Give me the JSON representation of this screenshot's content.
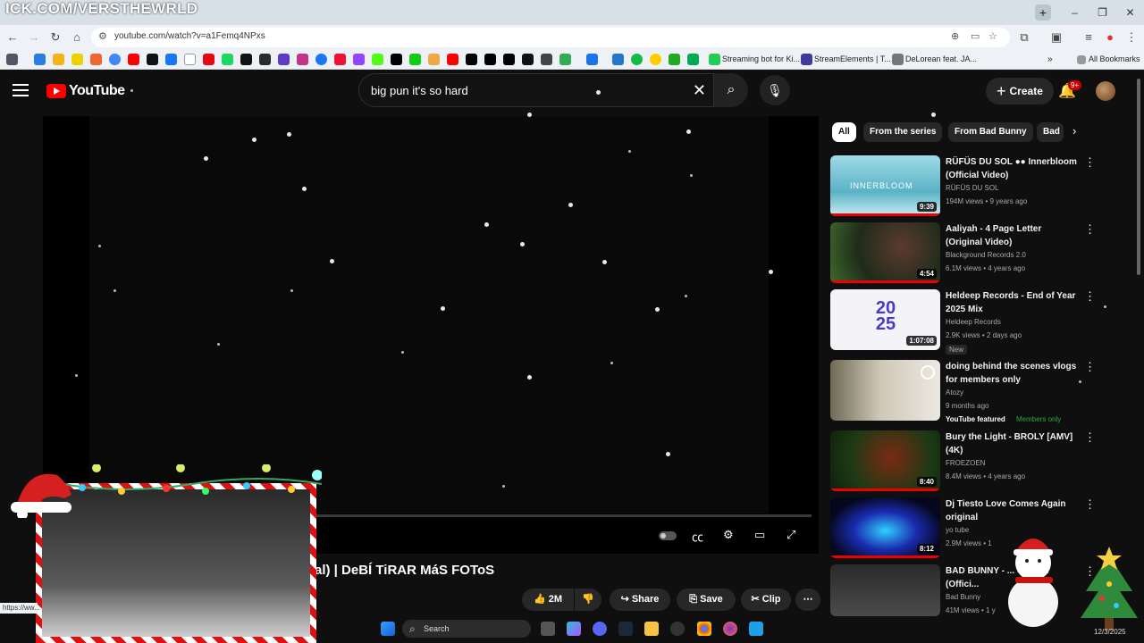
{
  "overlay": {
    "banner": "ICK.COM/VERSTHEWRLD"
  },
  "browser": {
    "url": "youtube.com/watch?v=a1Femq4NPxs",
    "bookmark_labels": [
      "Streaming bot for Ki...",
      "StreamElements | T...",
      "DeLorean feat. JA..."
    ],
    "all_bookmarks": "All Bookmarks",
    "status_url": "https://ww..."
  },
  "youtube": {
    "logo_text": "YouTube",
    "search_query": "big pun it's so hard",
    "create_label": "Create",
    "notif_badge": "9+",
    "video_title": "al) | DeBÍ TiRAR MáS FOToS",
    "actions": {
      "like": "2M",
      "share": "Share",
      "save": "Save",
      "clip": "Clip"
    },
    "chips": [
      "All",
      "From the series",
      "From Bad Bunny",
      "Bad"
    ],
    "recommendations": [
      {
        "title": "RÜFÜS DU SOL ●● Innerbloom (Official Video)",
        "channel": "RÜFÜS DU SOL",
        "meta": "194M views • 9 years ago",
        "duration": "9:39",
        "thumb_text": "INNERBLOOM"
      },
      {
        "title": "Aaliyah - 4 Page Letter (Original Video)",
        "channel": "Blackground Records 2.0",
        "meta": "6.1M views • 4 years ago",
        "duration": "4:54"
      },
      {
        "title": "Heldeep Records - End of Year 2025 Mix",
        "channel": "Heldeep Records",
        "meta": "2.9K views • 2 days ago",
        "duration": "1:07:08",
        "badge": "New",
        "thumb_text": "20 25"
      },
      {
        "title": "doing behind the scenes vlogs for members only",
        "channel": "Atozy",
        "meta": "9 months ago",
        "featured": "YouTube featured",
        "members": "Members only"
      },
      {
        "title": "Bury the Light - BROLY [AMV] (4K)",
        "channel": "FROEZOEN",
        "meta": "8.4M views • 4 years ago",
        "duration": "8:40"
      },
      {
        "title": "Dj Tiesto  Love Comes Again original",
        "channel": "yo tube",
        "meta": "2.9M views • 1",
        "duration": "8:12"
      },
      {
        "title": "BAD BUNNY - ... CASAR (Offici...",
        "channel": "Bad Bunny",
        "meta": "41M views • 1 y"
      }
    ]
  },
  "taskbar": {
    "search": "Search",
    "clock": "12/3/2025"
  }
}
